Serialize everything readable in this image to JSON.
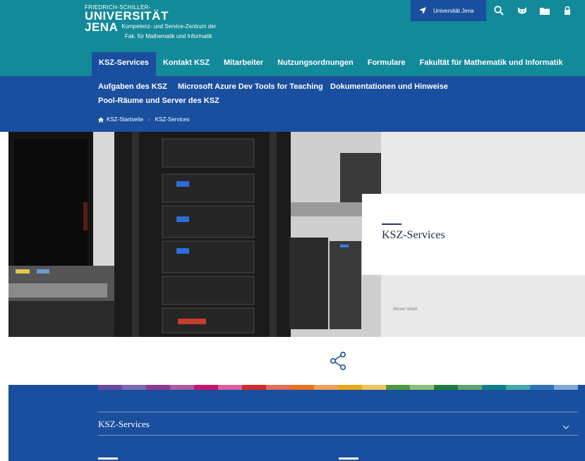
{
  "logo": {
    "line1": "FRIEDRICH-SCHILLER-",
    "line2": "UNIVERSITÄT",
    "line3": "JENA",
    "sub1": "Kompetenz- und Service-Zentrum der",
    "sub2": "Fak. für Mathematik und Informatik"
  },
  "header": {
    "uni_link": "Universität Jena",
    "colors": {
      "header": "#138a99",
      "nav": "#1a4e9e"
    }
  },
  "mainnav": [
    "KSZ-Services",
    "Kontakt KSZ",
    "Mitarbeiter",
    "Nutzungsordnungen",
    "Formulare",
    "Fakultät für Mathematik und Informatik"
  ],
  "subnav": {
    "item1": "Aufgaben des KSZ",
    "item2": "Microsoft Azure Dev Tools for Teaching",
    "item3": "Dokumentationen und Hinweise",
    "item4": "Pool-Räume und Server des KSZ"
  },
  "breadcrumb": {
    "home": "KSZ-Startseite",
    "current": "KSZ-Services"
  },
  "hero": {
    "title": "KSZ-Services",
    "caption": "Server smart"
  },
  "footer": {
    "accordion_title": "KSZ-Services",
    "stripe_colors": [
      "#6a4a9c",
      "#7b6bb5",
      "#8e3a8f",
      "#b05aa3",
      "#c4176c",
      "#d9609a",
      "#d32a2a",
      "#e06e57",
      "#e8731f",
      "#f0a05a",
      "#e8a814",
      "#f3c45d",
      "#4e9a3e",
      "#8cc17a",
      "#227b3d",
      "#5ea46a",
      "#0f7f86",
      "#46a7ab",
      "#2f73b8",
      "#7fa8d8"
    ]
  }
}
